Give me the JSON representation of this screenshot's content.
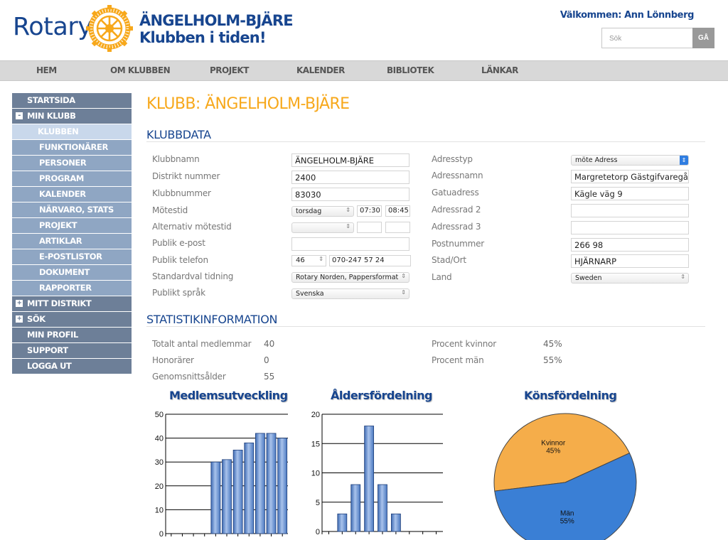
{
  "header": {
    "logo_text": "Rotary",
    "club_line1": "ÄNGELHOLM-BJÄRE",
    "club_line2": "Klubben i tiden!",
    "welcome": "Välkommen: Ann Lönnberg",
    "search_placeholder": "Sök",
    "search_button": "GÅ"
  },
  "topnav": [
    "HEM",
    "OM KLUBBEN",
    "PROJEKT",
    "KALENDER",
    "BIBLIOTEK",
    "LÄNKAR"
  ],
  "sidenav": {
    "startsida": "STARTSIDA",
    "min_klubb": "MIN KLUBB",
    "klubben": "KLUBBEN",
    "sub": [
      "FUNKTIONÄRER",
      "PERSONER",
      "PROGRAM",
      "KALENDER",
      "NÄRVARO, STATS",
      "PROJEKT",
      "ARTIKLAR",
      "E-POSTLISTOR",
      "DOKUMENT",
      "RAPPORTER"
    ],
    "mitt_distrikt": "MITT DISTRIKT",
    "sok": "SÖK",
    "min_profil": "MIN PROFIL",
    "support": "SUPPORT",
    "logga_ut": "LOGGA UT",
    "minus": "-",
    "plus": "+"
  },
  "page_title": "KLUBB: ÄNGELHOLM-BJÄRE",
  "klubbdata": {
    "title": "KLUBBDATA",
    "labels": {
      "klubbnamn": "Klubbnamn",
      "distrikt": "Distrikt nummer",
      "klubbnummer": "Klubbnummer",
      "motestid": "Mötestid",
      "alt_motestid": "Alternativ mötestid",
      "epost": "Publik e-post",
      "telefon": "Publik telefon",
      "tidning": "Standardval tidning",
      "sprak": "Publikt språk",
      "adresstyp": "Adresstyp",
      "adressnamn": "Adressnamn",
      "gatuadress": "Gatuadress",
      "adressrad2": "Adressrad 2",
      "adressrad3": "Adressrad 3",
      "postnummer": "Postnummer",
      "stad": "Stad/Ort",
      "land": "Land"
    },
    "values": {
      "klubbnamn": "ÄNGELHOLM-BJÄRE",
      "distrikt": "2400",
      "klubbnummer": "83030",
      "motesdag": "torsdag",
      "motes_start": "07:30",
      "motes_slut": "08:45",
      "tel_prefix": "46",
      "telefon": "070-247 57 24",
      "tidning": "Rotary Norden, Pappersformat",
      "sprak": "Svenska",
      "adresstyp": "möte Adress",
      "adressnamn": "Margretetorp Gästgifvaregård",
      "gatuadress": "Kägle väg 9",
      "postnummer": "266 98",
      "stad": "HJÄRNARP",
      "land": "Sweden"
    }
  },
  "statistik": {
    "title": "STATISTIKINFORMATION",
    "totalt_label": "Totalt antal medlemmar",
    "totalt_value": "40",
    "honorarer_label": "Honorärer",
    "honorarer_value": "0",
    "alder_label": "Genomsnittsålder",
    "alder_value": "55",
    "kvinnor_label": "Procent kvinnor",
    "kvinnor_value": "45%",
    "man_label": "Procent män",
    "man_value": "55%"
  },
  "chart_data": [
    {
      "type": "bar",
      "title": "Medlemsutveckling",
      "ylim": [
        0,
        50
      ],
      "yticks": [
        0,
        10,
        20,
        30,
        40,
        50
      ],
      "values": [
        0,
        0,
        0,
        0,
        30,
        31,
        35,
        38,
        42,
        42,
        40
      ],
      "color": "#6f94cf"
    },
    {
      "type": "bar",
      "title": "Åldersfördelning",
      "ylim": [
        0,
        20
      ],
      "yticks": [
        0,
        5,
        10,
        15,
        20
      ],
      "values": [
        0,
        3,
        8,
        18,
        8,
        3,
        0,
        0,
        0
      ],
      "color": "#6f94cf"
    },
    {
      "type": "pie",
      "title": "Könsfördelning",
      "slices": [
        {
          "label": "Kvinnor",
          "value": 45,
          "text": "45%",
          "color": "#f5ad4a"
        },
        {
          "label": "Män",
          "value": 55,
          "text": "55%",
          "color": "#3a7fd5"
        }
      ]
    }
  ]
}
